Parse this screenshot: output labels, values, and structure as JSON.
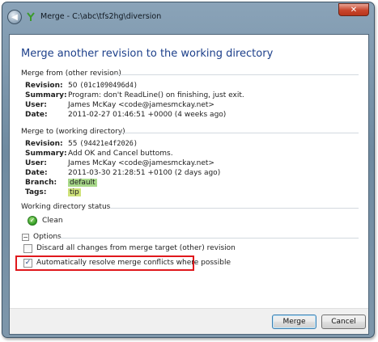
{
  "window": {
    "title": "Merge - C:\\abc\\tfs2hg\\diversion",
    "close_glyph": "✕",
    "back_glyph": "◀"
  },
  "dialog": {
    "heading": "Merge another revision to the working directory"
  },
  "merge_from": {
    "group_label": "Merge from (other revision)",
    "revision_label": "Revision:",
    "revision_num": "50",
    "revision_hash": "(01c1090496d4)",
    "summary_label": "Summary:",
    "summary": "Program: don't ReadLine() on finishing, just exit.",
    "user_label": "User:",
    "user": "James McKay <code@jamesmckay.net>",
    "date_label": "Date:",
    "date": "2011-02-27 01:46:51 +0000 (4 weeks ago)"
  },
  "merge_to": {
    "group_label": "Merge to (working directory)",
    "revision_label": "Revision:",
    "revision_num": "55",
    "revision_hash": "(94421e4f2026)",
    "summary_label": "Summary:",
    "summary": "Add OK and Cancel buttoms.",
    "user_label": "User:",
    "user": "James McKay <code@jamesmckay.net>",
    "date_label": "Date:",
    "date": "2011-03-30 21:28:51 +0100 (2 days ago)",
    "branch_label": "Branch:",
    "branch": "default",
    "tags_label": "Tags:",
    "tags": "tip"
  },
  "status": {
    "group_label": "Working directory status",
    "value": "Clean",
    "icon_glyph": "✓"
  },
  "options": {
    "collapse_glyph": "−",
    "label": "Options",
    "discard_label": "Discard all changes from merge target (other) revision",
    "discard_checked": false,
    "autoresolve_label": "Automatically resolve merge conflicts where possible",
    "autoresolve_checked": true,
    "check_glyph": "✓"
  },
  "buttons": {
    "merge": "Merge",
    "cancel": "Cancel"
  },
  "colors": {
    "heading": "#1c3f8a",
    "branch_bg": "#a8d98a",
    "tag_bg": "#cfe27a",
    "highlight": "#e0181c"
  }
}
